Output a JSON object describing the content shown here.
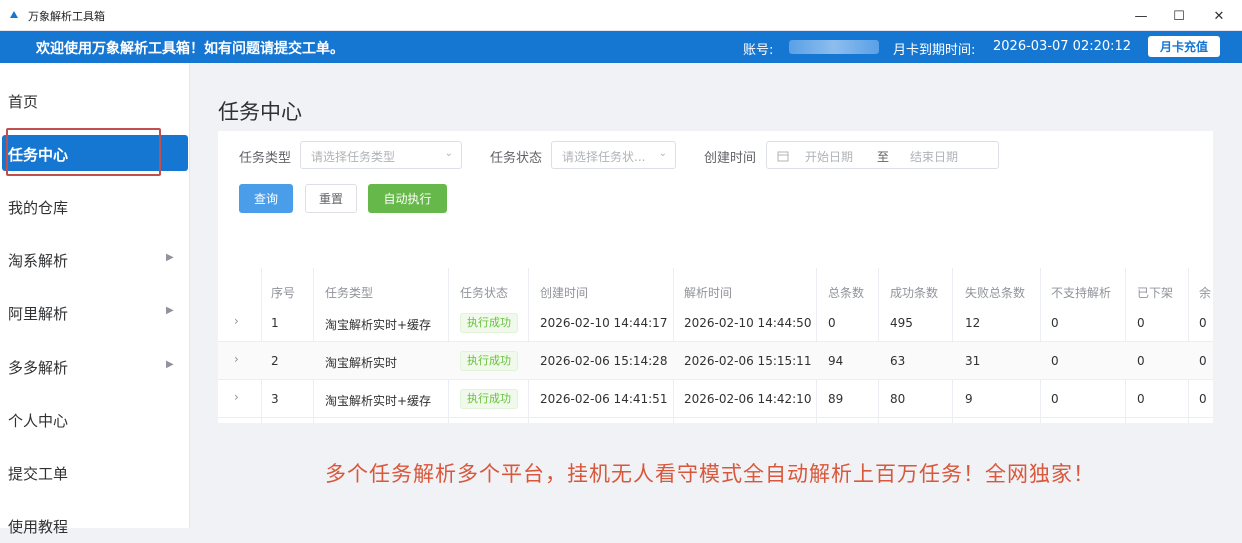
{
  "window": {
    "title": "万象解析工具箱",
    "minimize": "—",
    "maximize": "☐",
    "close": "✕"
  },
  "banner": {
    "welcome": "欢迎使用万象解析工具箱！如有问题请提交工单。",
    "account_label": "账号:",
    "expire_label": "月卡到期时间:",
    "expire_value": "2026-03-07 02:20:12",
    "recharge_label": "月卡充值"
  },
  "sidebar": {
    "items": [
      {
        "label": "首页",
        "has_arrow": false
      },
      {
        "label": "任务中心",
        "has_arrow": false,
        "active": true
      },
      {
        "label": "我的仓库",
        "has_arrow": false
      },
      {
        "label": "淘系解析",
        "has_arrow": true
      },
      {
        "label": "阿里解析",
        "has_arrow": true
      },
      {
        "label": "多多解析",
        "has_arrow": true
      },
      {
        "label": "个人中心",
        "has_arrow": false
      },
      {
        "label": "提交工单",
        "has_arrow": false
      },
      {
        "label": "使用教程",
        "has_arrow": false
      }
    ],
    "arrow_glyph": "▶"
  },
  "page": {
    "title": "任务中心"
  },
  "filters": {
    "task_type_label": "任务类型",
    "task_type_placeholder": "请选择任务类型",
    "task_status_label": "任务状态",
    "task_status_placeholder": "请选择任务状...",
    "created_label": "创建时间",
    "start_placeholder": "开始日期",
    "range_sep": "至",
    "end_placeholder": "结束日期",
    "query_button": "查询",
    "reset_button": "重置",
    "auto_button": "自动执行"
  },
  "table": {
    "headers": [
      "序号",
      "任务类型",
      "任务状态",
      "创建时间",
      "解析时间",
      "总条数",
      "成功条数",
      "失败总条数",
      "不支持解析",
      "已下架",
      "余"
    ],
    "rows": [
      {
        "no": "1",
        "type": "淘宝解析实时+缓存",
        "status": "执行成功",
        "created": "2026-02-10 14:44:17",
        "parsed": "2026-02-10 14:44:50",
        "total": "0",
        "success": "495",
        "failed": "12",
        "unsupported": "0",
        "removed": "0",
        "rest": "0"
      },
      {
        "no": "2",
        "type": "淘宝解析实时",
        "status": "执行成功",
        "created": "2026-02-06 15:14:28",
        "parsed": "2026-02-06 15:15:11",
        "total": "94",
        "success": "63",
        "failed": "31",
        "unsupported": "0",
        "removed": "0",
        "rest": "0"
      },
      {
        "no": "3",
        "type": "淘宝解析实时+缓存",
        "status": "执行成功",
        "created": "2026-02-06 14:41:51",
        "parsed": "2026-02-06 14:42:10",
        "total": "89",
        "success": "80",
        "failed": "9",
        "unsupported": "0",
        "removed": "0",
        "rest": "0"
      }
    ],
    "expand_glyph": "›"
  },
  "promo": "多个任务解析多个平台，挂机无人看守模式全自动解析上百万任务！全网独家！",
  "colors": {
    "brand_blue": "#1677d2",
    "success_green": "#67b84a",
    "promo_red": "#d9573b",
    "highlight_red": "#c0504d"
  }
}
